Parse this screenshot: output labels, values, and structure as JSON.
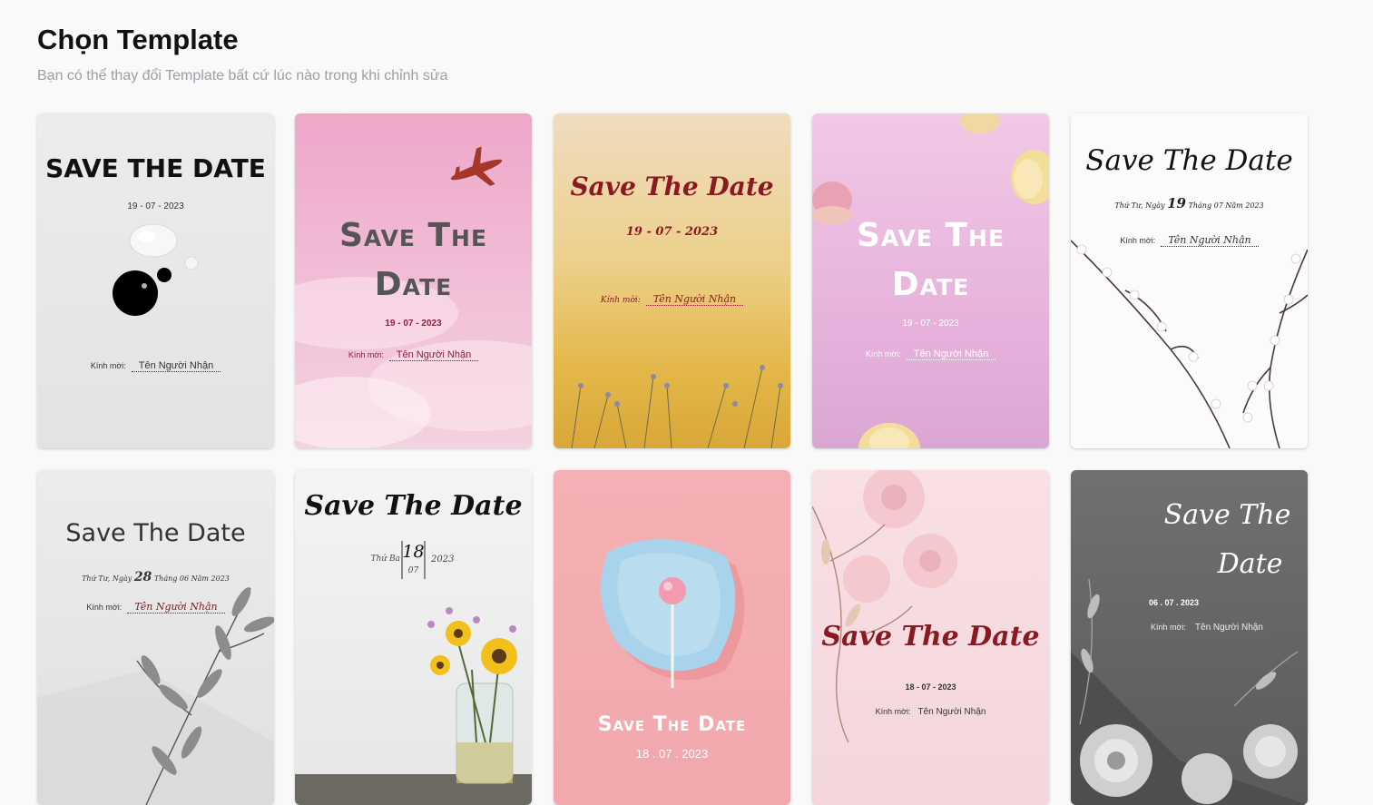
{
  "header": {
    "title": "Chọn Template",
    "subtitle": "Bạn có thể thay đổi Template bất cứ lúc nào trong khi chỉnh sửa"
  },
  "templates": [
    {
      "title": "SAVE THE DATE",
      "date": "19 - 07 - 2023",
      "invite_label": "Kính mời:",
      "recipient": "Tên Người Nhận"
    },
    {
      "title_line1": "Save The",
      "title_line2": "Date",
      "date": "19 - 07 - 2023",
      "invite_label": "Kính mời:",
      "recipient": "Tên Người Nhận"
    },
    {
      "title": "Save The Date",
      "date": "19 - 07 - 2023",
      "invite_label": "Kính mời:",
      "recipient": "Tên Người Nhận"
    },
    {
      "title_line1": "Save The",
      "title_line2": "Date",
      "date": "19 - 07 - 2023",
      "invite_label": "Kính mời:",
      "recipient": "Tên Người Nhận"
    },
    {
      "title": "Save The Date",
      "date_prefix": "Thứ Tư, Ngày",
      "day": "19",
      "date_suffix": "Tháng 07 Năm 2023",
      "invite_label": "Kính mời:",
      "recipient": "Tên Người Nhận"
    },
    {
      "title": "Save  The  Date",
      "date_prefix": "Thứ Tư, Ngày",
      "day": "28",
      "date_suffix": "Tháng 06 Năm 2023",
      "invite_label": "Kính mời:",
      "recipient": "Tên Người Nhận"
    },
    {
      "title": "Save The Date",
      "weekday": "Thứ Ba",
      "day": "18",
      "month": "07",
      "year": "2023"
    },
    {
      "title": "Save The Date",
      "date": "18 . 07 . 2023"
    },
    {
      "title": "Save The Date",
      "date": "18 - 07 - 2023",
      "invite_label": "Kính mời:",
      "recipient": "Tên Người Nhận"
    },
    {
      "title_line1": "Save The",
      "title_line2": "Date",
      "date": "06 . 07 . 2023",
      "invite_label": "Kính mời:",
      "recipient": "Tên Người Nhận"
    }
  ]
}
